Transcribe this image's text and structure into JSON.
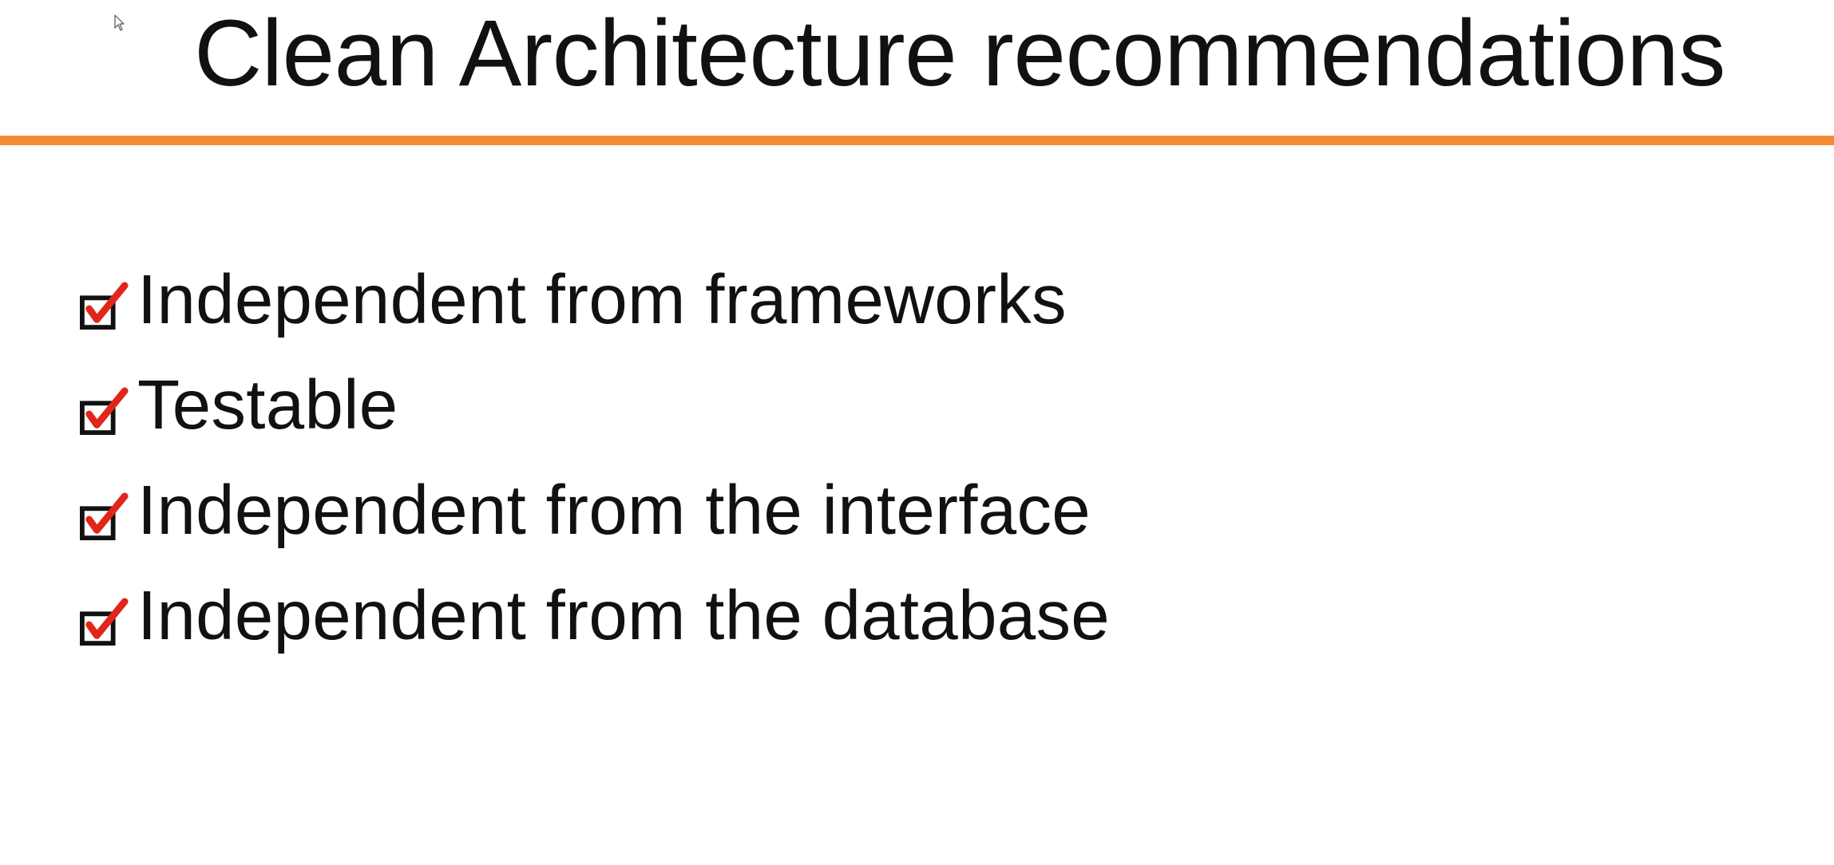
{
  "slide": {
    "title": "Clean Architecture recommendations",
    "accent_color": "#f28c33",
    "items": [
      {
        "label": "Independent from frameworks",
        "icon": "checked-box-icon",
        "checked": true
      },
      {
        "label": "Testable",
        "icon": "checked-box-icon",
        "checked": true
      },
      {
        "label": "Independent from the interface",
        "icon": "checked-box-icon",
        "checked": true
      },
      {
        "label": "Independent from the database",
        "icon": "checked-box-icon",
        "checked": true
      }
    ]
  },
  "colors": {
    "checkmark": "#e0261b",
    "text": "#111111",
    "background": "#ffffff"
  }
}
